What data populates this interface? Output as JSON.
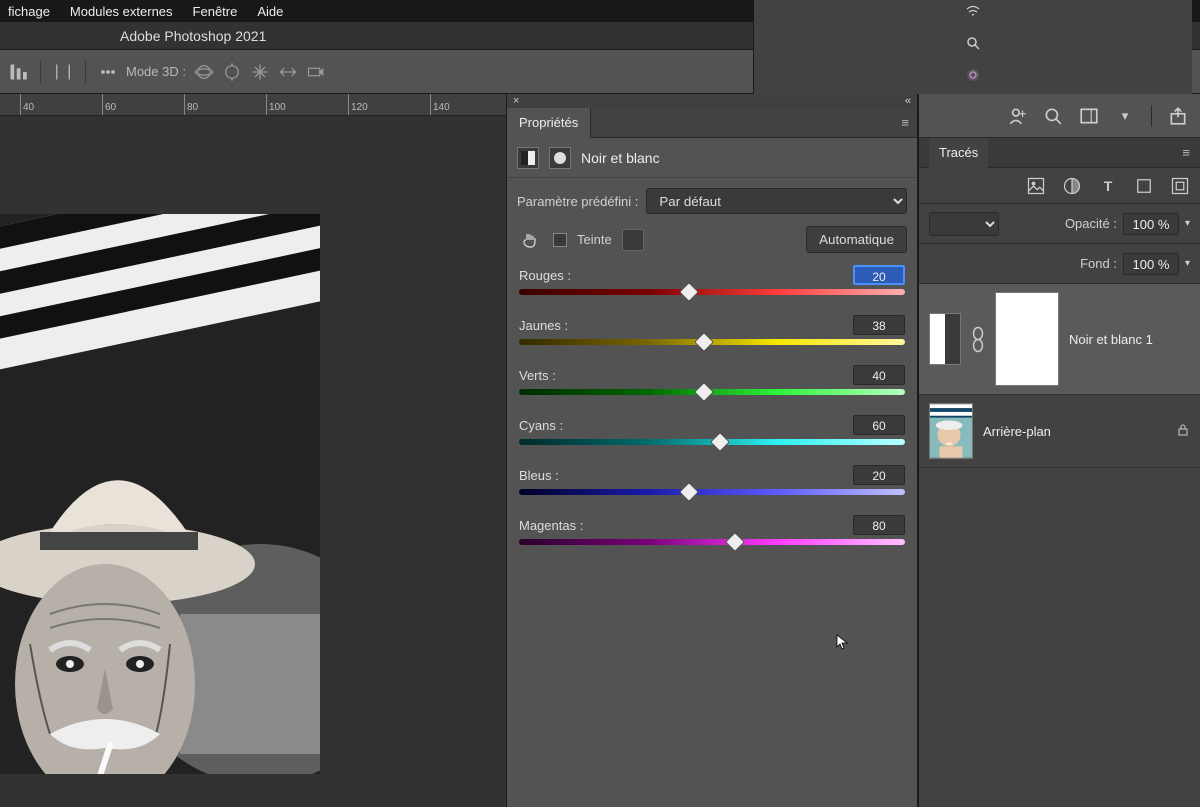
{
  "menubar": {
    "items": [
      "fichage",
      "Modules externes",
      "Fenêtre",
      "Aide"
    ]
  },
  "app_title": "Adobe Photoshop 2021",
  "optionsbar": {
    "mode3d_label": "Mode 3D :"
  },
  "ruler": {
    "ticks": [
      40,
      60,
      80,
      100,
      120,
      140
    ]
  },
  "properties": {
    "tab_label": "Propriétés",
    "adjustment_title": "Noir et blanc",
    "preset_label": "Paramètre prédéfini :",
    "preset_value": "Par défaut",
    "tint_label": "Teinte",
    "auto_label": "Automatique",
    "sliders": [
      {
        "label": "Rouges :",
        "value": 20,
        "selected": true,
        "grad": "gr-red",
        "pos": 44
      },
      {
        "label": "Jaunes :",
        "value": 38,
        "selected": false,
        "grad": "gr-yellow",
        "pos": 48
      },
      {
        "label": "Verts :",
        "value": 40,
        "selected": false,
        "grad": "gr-green",
        "pos": 48
      },
      {
        "label": "Cyans :",
        "value": 60,
        "selected": false,
        "grad": "gr-cyan",
        "pos": 52
      },
      {
        "label": "Bleus :",
        "value": 20,
        "selected": false,
        "grad": "gr-blue",
        "pos": 44
      },
      {
        "label": "Magentas :",
        "value": 80,
        "selected": false,
        "grad": "gr-magenta",
        "pos": 56
      }
    ]
  },
  "right": {
    "tab_traces": "Tracés",
    "opacity_label": "Opacité :",
    "opacity_value": "100 %",
    "fill_label": "Fond :",
    "fill_value": "100 %",
    "layers": [
      {
        "name": "Noir et blanc 1",
        "type": "adjustment",
        "selected": true
      },
      {
        "name": "Arrière-plan",
        "type": "background",
        "locked": true
      }
    ]
  }
}
